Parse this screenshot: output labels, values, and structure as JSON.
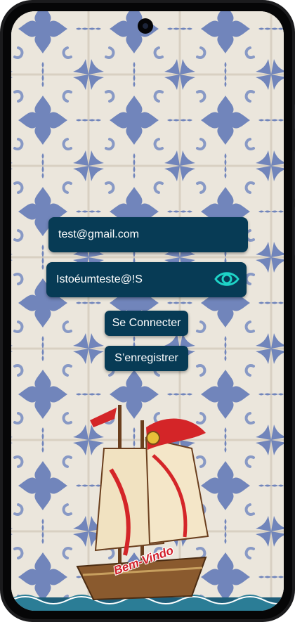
{
  "login": {
    "email_value": "test@gmail.com",
    "password_value": "Istoéumteste@!S",
    "connect_label": "Se Connecter",
    "register_label": "S’enregistrer"
  },
  "welcome": {
    "banner_text": "Bem-Vindo"
  },
  "icons": {
    "visibility_toggle": "eye-icon",
    "flag": "portugal-flag-icon"
  },
  "colors": {
    "field_background": "#073b55",
    "tile_blue": "#5872b6",
    "eye_icon": "#1ed3c7",
    "banner_red": "#d21f2a"
  }
}
